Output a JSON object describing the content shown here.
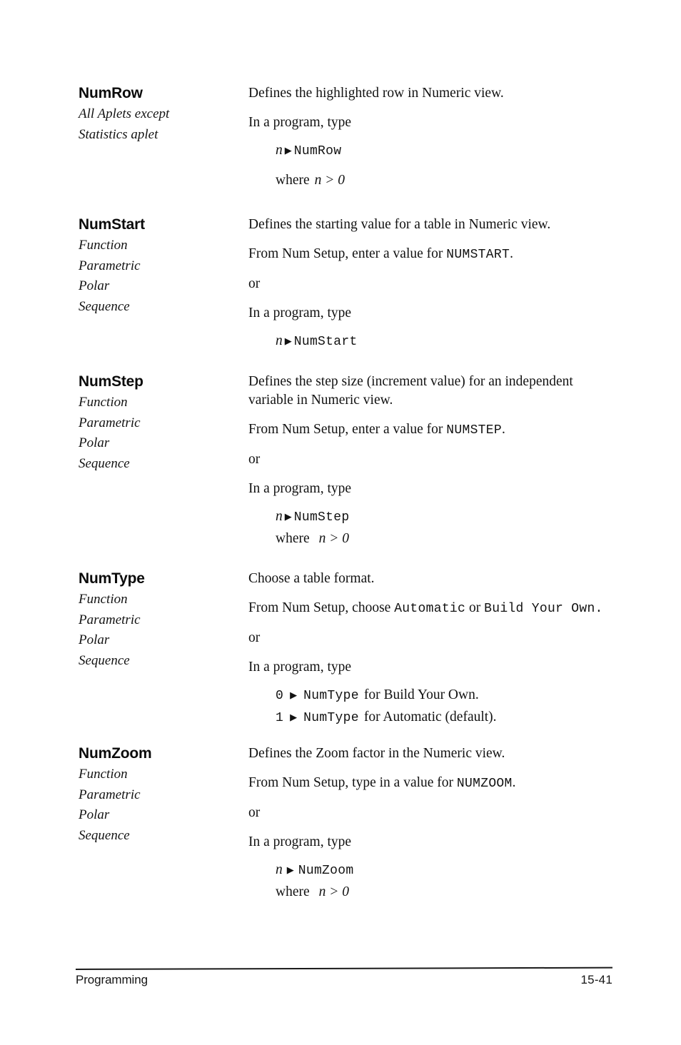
{
  "page": {
    "footer_label": "Programming",
    "page_number": "15-41"
  },
  "entries": [
    {
      "term": "NumRow",
      "applets": [
        "All Aplets except",
        "Statistics aplet"
      ],
      "description": "Defines the highlighted row in Numeric view.",
      "setup_line": null,
      "or_label": null,
      "program_label": "In a program, type",
      "code": [
        {
          "operand": "n",
          "arrow": "▶",
          "command": "NumRow",
          "suffix": ""
        }
      ],
      "where": "where",
      "where_expr": "n > 0"
    },
    {
      "term": "NumStart",
      "applets": [
        "Function",
        "Parametric",
        "Polar",
        "Sequence"
      ],
      "description": "Defines the starting value for a table in Numeric view.",
      "setup_prefix": "From Num Setup, enter a value for ",
      "setup_mono": "NUMSTART",
      "setup_suffix": ".",
      "or_label": "or",
      "program_label": "In a program, type",
      "code": [
        {
          "operand": "n",
          "arrow": "▶",
          "command": "NumStart",
          "suffix": ""
        }
      ],
      "where": null,
      "where_expr": null
    },
    {
      "term": "NumStep",
      "applets": [
        "Function",
        "Parametric",
        "Polar",
        "Sequence"
      ],
      "description": "Defines the step size (increment value) for an independent variable in Numeric view.",
      "setup_prefix": "From Num Setup, enter a value for ",
      "setup_mono": "NUMSTEP",
      "setup_suffix": ".",
      "or_label": "or",
      "program_label": "In a program, type",
      "code": [
        {
          "operand": "n",
          "arrow": "▶",
          "command": "NumStep",
          "suffix": ""
        }
      ],
      "where": "where",
      "where_expr": "n > 0"
    },
    {
      "term": "NumType",
      "applets": [
        "Function",
        "Parametric",
        "Polar",
        "Sequence"
      ],
      "description": "Choose a table format.",
      "setup_prefix": "From Num Setup, choose ",
      "setup_mono": "Automatic",
      "setup_mid": " or ",
      "setup_mono2": "Build Your Own.",
      "setup_suffix": "",
      "or_label": "or",
      "program_label": "In a program, type",
      "code": [
        {
          "operand": "0",
          "arrow": "▶",
          "command": "NumType",
          "suffix": "for Build Your Own."
        },
        {
          "operand": "1",
          "arrow": "▶",
          "command": "NumType",
          "suffix": "for Automatic (default)."
        }
      ],
      "where": null,
      "where_expr": null
    },
    {
      "term": "NumZoom",
      "applets": [
        "Function",
        "Parametric",
        "Polar",
        "Sequence"
      ],
      "description": "Defines the Zoom factor in the Numeric view.",
      "setup_prefix": "From Num Setup, type in a value for ",
      "setup_mono": "NUMZOOM",
      "setup_suffix": ".",
      "or_label": "or",
      "program_label": "In a program, type",
      "code": [
        {
          "operand": "n",
          "arrow": "▶",
          "command": "NumZoom",
          "suffix": ""
        }
      ],
      "where": "where",
      "where_expr": "n > 0"
    }
  ]
}
